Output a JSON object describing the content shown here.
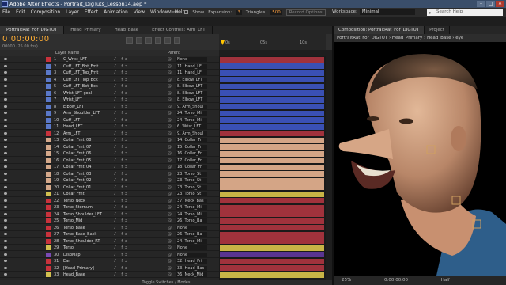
{
  "app": {
    "title": "Adobe After Effects - Portrait_DigTuts_Lesson14.aep *",
    "window_buttons": [
      "–",
      "□",
      "✕"
    ]
  },
  "menu": [
    "File",
    "Edit",
    "Composition",
    "Layer",
    "Effect",
    "Animation",
    "View",
    "Window",
    "Help"
  ],
  "toolbar": {
    "mesh_label": "Mesh:",
    "show_label": "Show",
    "expansion_label": "Expansion:",
    "expansion_value": "3",
    "triangles_label": "Triangles:",
    "triangles_value": "500",
    "record_options": "Record Options",
    "workspace_label": "Workspace:",
    "workspace_value": "Minimal",
    "search_placeholder": "Search Help"
  },
  "timeline": {
    "tabs": [
      "PortraitRat_For_DIGTUT",
      "Head_Primary",
      "Head_Base",
      "Effect Controls: Arm_LFT"
    ],
    "timecode": "0:00:00:00",
    "fps": "00000 (25.00 fps)",
    "col_layer_name": "Layer Name",
    "col_parent": "Parent",
    "ruler_ticks": [
      "0s",
      "05s",
      "10s"
    ],
    "footer": "Toggle Switches / Modes"
  },
  "layers": [
    {
      "num": "1",
      "name": "C_Wrist_LFT",
      "parent": "None",
      "color": "#c8323c",
      "bar": "#a0323c"
    },
    {
      "num": "2",
      "name": "Cuff_LFT_Bot_Frnt",
      "parent": "11. Hand_LF",
      "color": "#5a78c8",
      "bar": "#3a50b4"
    },
    {
      "num": "3",
      "name": "Cuff_LFT_Top_Frnt",
      "parent": "11. Hand_LF",
      "color": "#5a78c8",
      "bar": "#3a50b4"
    },
    {
      "num": "4",
      "name": "Cuff_LFT_Top_Bck",
      "parent": "8. Elbow_LFT",
      "color": "#5a78c8",
      "bar": "#3a50b4"
    },
    {
      "num": "5",
      "name": "Cuff_LFT_Bot_Bck",
      "parent": "8. Elbow_LFT",
      "color": "#5a78c8",
      "bar": "#3a50b4"
    },
    {
      "num": "6",
      "name": "Wrist_LFT goal",
      "parent": "8. Elbow_LFT",
      "color": "#5a78c8",
      "bar": "#3a50b4"
    },
    {
      "num": "7",
      "name": "Wrist_LFT",
      "parent": "8. Elbow_LFT",
      "color": "#5a78c8",
      "bar": "#3a50b4"
    },
    {
      "num": "8",
      "name": "Elbow_LFT",
      "parent": "9. Arm_Shoul",
      "color": "#5a78c8",
      "bar": "#3a50b4"
    },
    {
      "num": "9",
      "name": "Arm_Shoulder_LFT",
      "parent": "24. Torso_Mi",
      "color": "#5a78c8",
      "bar": "#3a50b4"
    },
    {
      "num": "10",
      "name": "Cuff_LFT",
      "parent": "24. Torso_Mi",
      "color": "#5a78c8",
      "bar": "#3a50b4"
    },
    {
      "num": "11",
      "name": "Hand_LFT",
      "parent": "6. Wrist_LFT",
      "color": "#5a78c8",
      "bar": "#3a50b4"
    },
    {
      "num": "12",
      "name": "Arm_LFT",
      "parent": "9. Arm_Shoul",
      "color": "#c8323c",
      "bar": "#a0323c"
    },
    {
      "num": "13",
      "name": "Collar_Frnt_08",
      "parent": "14. Collar_Fr",
      "color": "#d4a88a",
      "bar": "#d4a586"
    },
    {
      "num": "14",
      "name": "Collar_Frnt_07",
      "parent": "15. Collar_Fr",
      "color": "#d4a88a",
      "bar": "#d4a586"
    },
    {
      "num": "15",
      "name": "Collar_Frnt_06",
      "parent": "16. Collar_Fr",
      "color": "#d4a88a",
      "bar": "#d4a586"
    },
    {
      "num": "16",
      "name": "Collar_Frnt_05",
      "parent": "17. Collar_Fr",
      "color": "#d4a88a",
      "bar": "#d4a586"
    },
    {
      "num": "17",
      "name": "Collar_Frnt_04",
      "parent": "18. Collar_Fr",
      "color": "#d4a88a",
      "bar": "#d4a586"
    },
    {
      "num": "18",
      "name": "Collar_Frnt_03",
      "parent": "23. Torso_St",
      "color": "#d4a88a",
      "bar": "#d4a586"
    },
    {
      "num": "19",
      "name": "Collar_Frnt_02",
      "parent": "23. Torso_St",
      "color": "#d4a88a",
      "bar": "#d4a586"
    },
    {
      "num": "20",
      "name": "Collar_Frnt_01",
      "parent": "23. Torso_St",
      "color": "#d4a88a",
      "bar": "#d4a586"
    },
    {
      "num": "21",
      "name": "Collar_Frnt",
      "parent": "23. Torso_St",
      "color": "#d2c050",
      "bar": "#c8b446"
    },
    {
      "num": "22",
      "name": "Torso_Neck",
      "parent": "37. Neck_Bas",
      "color": "#c8323c",
      "bar": "#a0323c"
    },
    {
      "num": "23",
      "name": "Torso_Sternum",
      "parent": "24. Torso_Mi",
      "color": "#c8323c",
      "bar": "#a0323c"
    },
    {
      "num": "24",
      "name": "Torso_Shoulder_LFT",
      "parent": "24. Torso_Mi",
      "color": "#c8323c",
      "bar": "#a0323c"
    },
    {
      "num": "25",
      "name": "Torso_Mid",
      "parent": "26. Torso_Ba",
      "color": "#c8323c",
      "bar": "#a0323c"
    },
    {
      "num": "26",
      "name": "Torso_Base",
      "parent": "None",
      "color": "#c8323c",
      "bar": "#a0323c"
    },
    {
      "num": "27",
      "name": "Torso_Base_Back",
      "parent": "26. Torso_Ba",
      "color": "#c8323c",
      "bar": "#a0323c"
    },
    {
      "num": "28",
      "name": "Torso_Shoulder_RT",
      "parent": "24. Torso_Mi",
      "color": "#c8323c",
      "bar": "#a0323c"
    },
    {
      "num": "29",
      "name": "Torso",
      "parent": "None",
      "color": "#d2c050",
      "bar": "#c8b446"
    },
    {
      "num": "30",
      "name": "DispMap",
      "parent": "None",
      "color": "#7a4ab4",
      "bar": "#5a3490"
    },
    {
      "num": "31",
      "name": "Ear",
      "parent": "32. Head_Pri",
      "color": "#c8323c",
      "bar": "#a0323c"
    },
    {
      "num": "32",
      "name": "[Head_Primary]",
      "parent": "33. Head_Bas",
      "color": "#c8323c",
      "bar": "#a0323c"
    },
    {
      "num": "33",
      "name": "Head_Base",
      "parent": "36. Neck_Mid",
      "color": "#d2c050",
      "bar": "#c8b446"
    }
  ],
  "composition": {
    "tabs": [
      "Composition: PortraitRat_For_DIGTUT",
      "Project"
    ],
    "breadcrumb": [
      "PortraitRat_For_DIGTUT",
      "Head_Primary",
      "Head_Base",
      "eye"
    ],
    "zoom": "25%",
    "time": "0:00:00:00",
    "resolution": "Half"
  }
}
